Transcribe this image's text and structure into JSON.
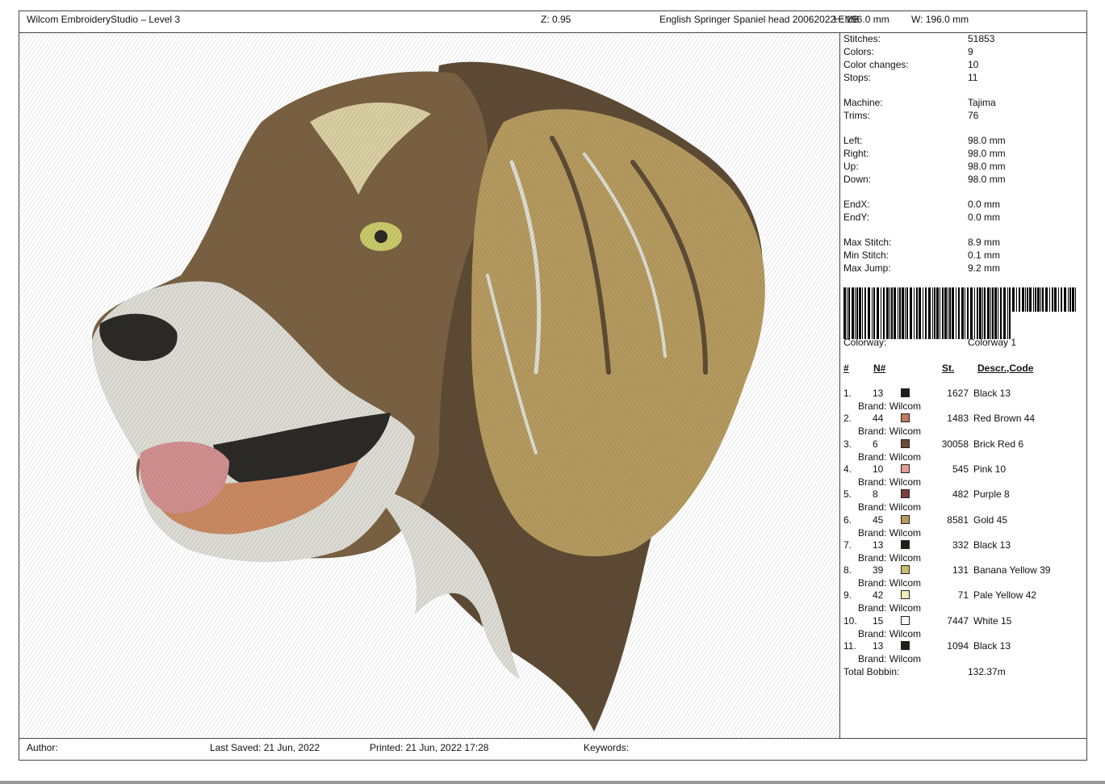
{
  "header": {
    "app_title": "Wilcom EmbroideryStudio – Level 3",
    "zoom": "Z: 0.95",
    "file_name": "English Springer Spaniel head 20062022.EMB",
    "height": "H: 196.0 mm",
    "width": "W: 196.0 mm"
  },
  "stats": [
    {
      "label": "Stitches:",
      "value": "51853"
    },
    {
      "label": "Colors:",
      "value": "9"
    },
    {
      "label": "Color changes:",
      "value": "10"
    },
    {
      "label": "Stops:",
      "value": "11"
    },
    {
      "label": "Machine:",
      "value": "Tajima"
    },
    {
      "label": "Trims:",
      "value": "76"
    },
    {
      "label": "Left:",
      "value": "98.0 mm"
    },
    {
      "label": "Right:",
      "value": "98.0 mm"
    },
    {
      "label": "Up:",
      "value": "98.0 mm"
    },
    {
      "label": "Down:",
      "value": "98.0 mm"
    },
    {
      "label": "EndX:",
      "value": "0.0 mm"
    },
    {
      "label": "EndY:",
      "value": "0.0 mm"
    },
    {
      "label": "Max Stitch:",
      "value": "8.9 mm"
    },
    {
      "label": "Min Stitch:",
      "value": "0.1 mm"
    },
    {
      "label": "Max Jump:",
      "value": "9.2 mm"
    }
  ],
  "colorway": {
    "label": "Colorway:",
    "value": "Colorway 1"
  },
  "table_headers": {
    "num": "#",
    "n": "N#",
    "st": "St.",
    "descr": "Descr.,Code"
  },
  "colors": [
    {
      "idx": "1.",
      "n": "13",
      "st": "1627",
      "descr": "Black 13",
      "brand": "Brand: Wilcom",
      "color": "#1e1e1c"
    },
    {
      "idx": "2.",
      "n": "44",
      "st": "1483",
      "descr": "Red Brown 44",
      "brand": "Brand: Wilcom",
      "color": "#c07a5c"
    },
    {
      "idx": "3.",
      "n": "6",
      "st": "30058",
      "descr": "Brick Red 6",
      "brand": "Brand: Wilcom",
      "color": "#6b4a33"
    },
    {
      "idx": "4.",
      "n": "10",
      "st": "545",
      "descr": "Pink 10",
      "brand": "Brand: Wilcom",
      "color": "#e59a9a"
    },
    {
      "idx": "5.",
      "n": "8",
      "st": "482",
      "descr": "Purple 8",
      "brand": "Brand: Wilcom",
      "color": "#7a3c3c"
    },
    {
      "idx": "6.",
      "n": "45",
      "st": "8581",
      "descr": "Gold 45",
      "brand": "Brand: Wilcom",
      "color": "#b89a5a"
    },
    {
      "idx": "7.",
      "n": "13",
      "st": "332",
      "descr": "Black 13",
      "brand": "Brand: Wilcom",
      "color": "#1e1e1c"
    },
    {
      "idx": "8.",
      "n": "39",
      "st": "131",
      "descr": "Banana Yellow 39",
      "brand": "Brand: Wilcom",
      "color": "#c8bd6c"
    },
    {
      "idx": "9.",
      "n": "42",
      "st": "71",
      "descr": "Pale Yellow 42",
      "brand": "Brand: Wilcom",
      "color": "#f3eebb"
    },
    {
      "idx": "10.",
      "n": "15",
      "st": "7447",
      "descr": "White 15",
      "brand": "Brand: Wilcom",
      "color": "#ffffff"
    },
    {
      "idx": "11.",
      "n": "13",
      "st": "1094",
      "descr": "Black 13",
      "brand": "Brand: Wilcom",
      "color": "#1e1e1c"
    }
  ],
  "total_bobbin": {
    "label": "Total Bobbin:",
    "value": "132.37m"
  },
  "footer": {
    "author": "Author:",
    "last_saved": "Last Saved: 21 Jun, 2022",
    "printed": "Printed: 21 Jun, 2022 17:28",
    "keywords": "Keywords:"
  },
  "palette": {
    "fur_dark": "#5e4b35",
    "fur_mid": "#7a6142",
    "fur_gold": "#b59a5f",
    "fur_light": "#d9cfa3",
    "white": "#dcdcd4",
    "nose": "#2b2a27",
    "tongue": "#d28f8f",
    "lip": "#c98a62",
    "eye": "#c9c96a"
  }
}
